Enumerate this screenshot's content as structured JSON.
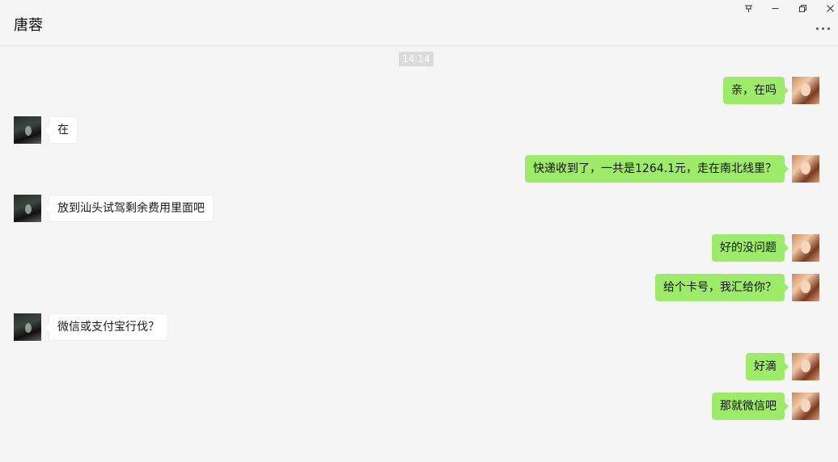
{
  "header": {
    "contact_name": "唐蓉",
    "window_controls": [
      {
        "name": "pin-icon",
        "glyph": "♆"
      },
      {
        "name": "minimize-icon",
        "glyph": "−"
      },
      {
        "name": "restore-icon",
        "glyph": "❐"
      },
      {
        "name": "close-icon",
        "glyph": "✕"
      }
    ],
    "more_icon": "more-icon"
  },
  "chat": {
    "timestamp": "14:14",
    "messages": [
      {
        "from": "me",
        "text": "亲，在吗"
      },
      {
        "from": "them",
        "text": "在"
      },
      {
        "from": "me",
        "text": "快递收到了，一共是1264.1元，走在南北线里？"
      },
      {
        "from": "them",
        "text": "放到汕头试驾剩余费用里面吧"
      },
      {
        "from": "me",
        "text": "好的没问题"
      },
      {
        "from": "me",
        "text": "给个卡号，我汇给你？"
      },
      {
        "from": "them",
        "text": "微信或支付宝行伐？"
      },
      {
        "from": "me",
        "text": "好滴"
      },
      {
        "from": "me",
        "text": "那就微信吧"
      }
    ]
  },
  "colors": {
    "background": "#f5f5f5",
    "my_bubble": "#9eea6a",
    "their_bubble": "#ffffff",
    "timestamp_bg": "#dadada"
  }
}
